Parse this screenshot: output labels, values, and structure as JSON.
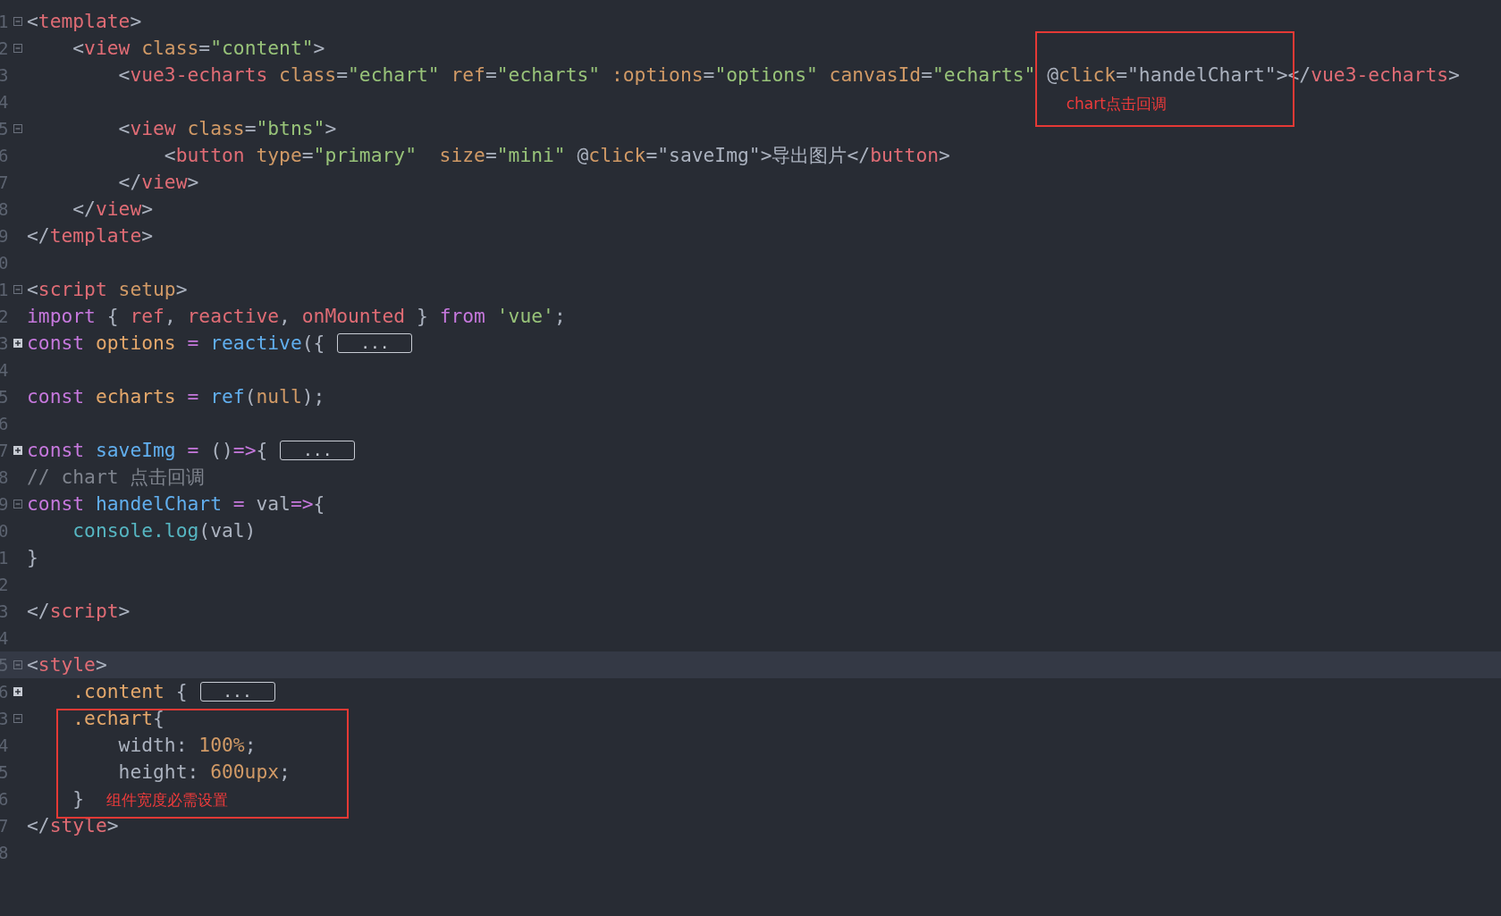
{
  "editor": {
    "lines": [
      {
        "number": "1",
        "fold_marker": {
          "collapsed": false
        },
        "current": false,
        "tokens": [
          {
            "text": "<",
            "color": "#abb2bf"
          },
          {
            "text": "template",
            "color": "#e06c75"
          },
          {
            "text": ">",
            "color": "#abb2bf"
          }
        ]
      },
      {
        "number": "2",
        "fold_marker": {
          "collapsed": false
        },
        "current": false,
        "tokens": [
          {
            "text": "    <",
            "color": "#abb2bf"
          },
          {
            "text": "view",
            "color": "#e06c75"
          },
          {
            "text": " class",
            "color": "#d19a66"
          },
          {
            "text": "=",
            "color": "#abb2bf"
          },
          {
            "text": "\"content\"",
            "color": "#98c379"
          },
          {
            "text": ">",
            "color": "#abb2bf"
          }
        ]
      },
      {
        "number": "3",
        "current": false,
        "tokens": [
          {
            "text": "        <",
            "color": "#abb2bf"
          },
          {
            "text": "vue3-echarts",
            "color": "#e06c75"
          },
          {
            "text": " class",
            "color": "#d19a66"
          },
          {
            "text": "=",
            "color": "#abb2bf"
          },
          {
            "text": "\"echart\"",
            "color": "#98c379"
          },
          {
            "text": " ref",
            "color": "#d19a66"
          },
          {
            "text": "=",
            "color": "#abb2bf"
          },
          {
            "text": "\"echarts\"",
            "color": "#98c379"
          },
          {
            "text": " :options",
            "color": "#d19a66"
          },
          {
            "text": "=",
            "color": "#abb2bf"
          },
          {
            "text": "\"options\"",
            "color": "#98c379"
          },
          {
            "text": " canvasId",
            "color": "#d19a66"
          },
          {
            "text": "=",
            "color": "#abb2bf"
          },
          {
            "text": "\"echarts\"",
            "color": "#98c379"
          },
          {
            "text": " @",
            "color": "#abb2bf"
          },
          {
            "text": "click",
            "color": "#d19a66"
          },
          {
            "text": "=\"handelChart\"></",
            "color": "#abb2bf"
          },
          {
            "text": "vue3-echarts",
            "color": "#e06c75"
          },
          {
            "text": ">",
            "color": "#abb2bf"
          }
        ]
      },
      {
        "number": "4",
        "current": false
      },
      {
        "number": "5",
        "fold_marker": {
          "collapsed": false
        },
        "current": false,
        "tokens": [
          {
            "text": "        <",
            "color": "#abb2bf"
          },
          {
            "text": "view",
            "color": "#e06c75"
          },
          {
            "text": " class",
            "color": "#d19a66"
          },
          {
            "text": "=",
            "color": "#abb2bf"
          },
          {
            "text": "\"btns\"",
            "color": "#98c379"
          },
          {
            "text": ">",
            "color": "#abb2bf"
          }
        ]
      },
      {
        "number": "6",
        "current": false,
        "tokens": [
          {
            "text": "            <",
            "color": "#abb2bf"
          },
          {
            "text": "button",
            "color": "#e06c75"
          },
          {
            "text": " type",
            "color": "#d19a66"
          },
          {
            "text": "=",
            "color": "#abb2bf"
          },
          {
            "text": "\"primary\"",
            "color": "#98c379"
          },
          {
            "text": "  size",
            "color": "#d19a66"
          },
          {
            "text": "=",
            "color": "#abb2bf"
          },
          {
            "text": "\"mini\"",
            "color": "#98c379"
          },
          {
            "text": " @",
            "color": "#abb2bf"
          },
          {
            "text": "click",
            "color": "#d19a66"
          },
          {
            "text": "=\"saveImg\">导出图片</",
            "color": "#abb2bf"
          },
          {
            "text": "button",
            "color": "#e06c75"
          },
          {
            "text": ">",
            "color": "#abb2bf"
          }
        ]
      },
      {
        "number": "7",
        "current": false,
        "tokens": [
          {
            "text": "        </",
            "color": "#abb2bf"
          },
          {
            "text": "view",
            "color": "#e06c75"
          },
          {
            "text": ">",
            "color": "#abb2bf"
          }
        ]
      },
      {
        "number": "8",
        "current": false,
        "tokens": [
          {
            "text": "    </",
            "color": "#abb2bf"
          },
          {
            "text": "view",
            "color": "#e06c75"
          },
          {
            "text": ">",
            "color": "#abb2bf"
          }
        ]
      },
      {
        "number": "9",
        "current": false,
        "tokens": [
          {
            "text": "</",
            "color": "#abb2bf"
          },
          {
            "text": "template",
            "color": "#e06c75"
          },
          {
            "text": ">",
            "color": "#abb2bf"
          }
        ]
      },
      {
        "number": "0",
        "current": false
      },
      {
        "number": "1",
        "fold_marker": {
          "collapsed": false
        },
        "current": false,
        "tokens": [
          {
            "text": "<",
            "color": "#abb2bf"
          },
          {
            "text": "script",
            "color": "#e06c75"
          },
          {
            "text": " setup",
            "color": "#d19a66"
          },
          {
            "text": ">",
            "color": "#abb2bf"
          }
        ]
      },
      {
        "number": "2",
        "current": false,
        "tokens": [
          {
            "text": "import",
            "color": "#c678dd"
          },
          {
            "text": " { ",
            "color": "#abb2bf"
          },
          {
            "text": "ref",
            "color": "#e06c75"
          },
          {
            "text": ", ",
            "color": "#abb2bf"
          },
          {
            "text": "reactive",
            "color": "#e06c75"
          },
          {
            "text": ", ",
            "color": "#abb2bf"
          },
          {
            "text": "onMounted",
            "color": "#e06c75"
          },
          {
            "text": " } ",
            "color": "#abb2bf"
          },
          {
            "text": "from",
            "color": "#c678dd"
          },
          {
            "text": " 'vue'",
            "color": "#98c379"
          },
          {
            "text": ";",
            "color": "#abb2bf"
          }
        ]
      },
      {
        "number": "3",
        "fold_marker": {
          "collapsed": true
        },
        "current": false,
        "tokens": [
          {
            "text": "const",
            "color": "#c678dd"
          },
          {
            "text": " options",
            "color": "#e5a86b"
          },
          {
            "text": " = ",
            "color": "#c678dd"
          },
          {
            "text": "reactive",
            "color": "#61afef"
          },
          {
            "text": "({",
            "color": "#abb2bf"
          }
        ],
        "folded_text": "..."
      },
      {
        "number": "4",
        "current": false
      },
      {
        "number": "5",
        "current": false,
        "tokens": [
          {
            "text": "const",
            "color": "#c678dd"
          },
          {
            "text": " echarts",
            "color": "#e5a86b"
          },
          {
            "text": " = ",
            "color": "#c678dd"
          },
          {
            "text": "ref",
            "color": "#61afef"
          },
          {
            "text": "(",
            "color": "#abb2bf"
          },
          {
            "text": "null",
            "color": "#d19a66"
          },
          {
            "text": ");",
            "color": "#abb2bf"
          }
        ]
      },
      {
        "number": "6",
        "current": false
      },
      {
        "number": "7",
        "fold_marker": {
          "collapsed": true
        },
        "current": false,
        "tokens": [
          {
            "text": "const",
            "color": "#c678dd"
          },
          {
            "text": " saveImg",
            "color": "#61afef"
          },
          {
            "text": " = ",
            "color": "#c678dd"
          },
          {
            "text": "()",
            "color": "#abb2bf"
          },
          {
            "text": "=>",
            "color": "#c678dd"
          },
          {
            "text": "{",
            "color": "#abb2bf"
          }
        ],
        "folded_text": "..."
      },
      {
        "number": "8",
        "current": false,
        "tokens": [
          {
            "text": "// chart 点击回调",
            "color": "#7f848e"
          }
        ]
      },
      {
        "number": "9",
        "fold_marker": {
          "collapsed": false
        },
        "current": false,
        "tokens": [
          {
            "text": "const",
            "color": "#c678dd"
          },
          {
            "text": " handelChart",
            "color": "#61afef"
          },
          {
            "text": " = ",
            "color": "#c678dd"
          },
          {
            "text": "val",
            "color": "#abb2bf"
          },
          {
            "text": "=>",
            "color": "#c678dd"
          },
          {
            "text": "{",
            "color": "#abb2bf"
          }
        ]
      },
      {
        "number": "0",
        "current": false,
        "tokens": [
          {
            "text": "    console.log",
            "color": "#56b6c2"
          },
          {
            "text": "(val)",
            "color": "#abb2bf"
          }
        ]
      },
      {
        "number": "1",
        "current": false,
        "tokens": [
          {
            "text": "}",
            "color": "#abb2bf"
          }
        ]
      },
      {
        "number": "2",
        "current": false
      },
      {
        "number": "3",
        "current": false,
        "tokens": [
          {
            "text": "</",
            "color": "#abb2bf"
          },
          {
            "text": "script",
            "color": "#e06c75"
          },
          {
            "text": ">",
            "color": "#abb2bf"
          }
        ]
      },
      {
        "number": "4",
        "current": false
      },
      {
        "number": "5",
        "fold_marker": {
          "collapsed": false
        },
        "current": true,
        "tokens": [
          {
            "text": "<",
            "color": "#abb2bf"
          },
          {
            "text": "style",
            "color": "#e06c75"
          },
          {
            "text": ">",
            "color": "#abb2bf"
          }
        ]
      },
      {
        "number": "6",
        "fold_marker": {
          "collapsed": true
        },
        "current": false,
        "tokens": [
          {
            "text": "    .content",
            "color": "#e5a86b"
          },
          {
            "text": " {",
            "color": "#abb2bf"
          }
        ],
        "folded_text": "..."
      },
      {
        "number": "3",
        "fold_marker": {
          "collapsed": false
        },
        "current": false,
        "tokens": [
          {
            "text": "    .echart",
            "color": "#e5a86b"
          },
          {
            "text": "{",
            "color": "#abb2bf"
          }
        ]
      },
      {
        "number": "4",
        "current": false,
        "tokens": [
          {
            "text": "        width: ",
            "color": "#abb2bf"
          },
          {
            "text": "100%",
            "color": "#d19a66"
          },
          {
            "text": ";",
            "color": "#abb2bf"
          }
        ]
      },
      {
        "number": "5",
        "current": false,
        "tokens": [
          {
            "text": "        height: ",
            "color": "#abb2bf"
          },
          {
            "text": "600upx",
            "color": "#d19a66"
          },
          {
            "text": ";",
            "color": "#abb2bf"
          }
        ]
      },
      {
        "number": "6",
        "current": false,
        "tokens": [
          {
            "text": "    }",
            "color": "#abb2bf"
          }
        ]
      },
      {
        "number": "7",
        "current": false,
        "tokens": [
          {
            "text": "</",
            "color": "#abb2bf"
          },
          {
            "text": "style",
            "color": "#e06c75"
          },
          {
            "text": ">",
            "color": "#abb2bf"
          }
        ]
      },
      {
        "number": "8",
        "current": false
      }
    ],
    "annotations": [
      {
        "note": "chart点击回调"
      },
      {
        "note": "组件宽度必需设置"
      }
    ]
  }
}
